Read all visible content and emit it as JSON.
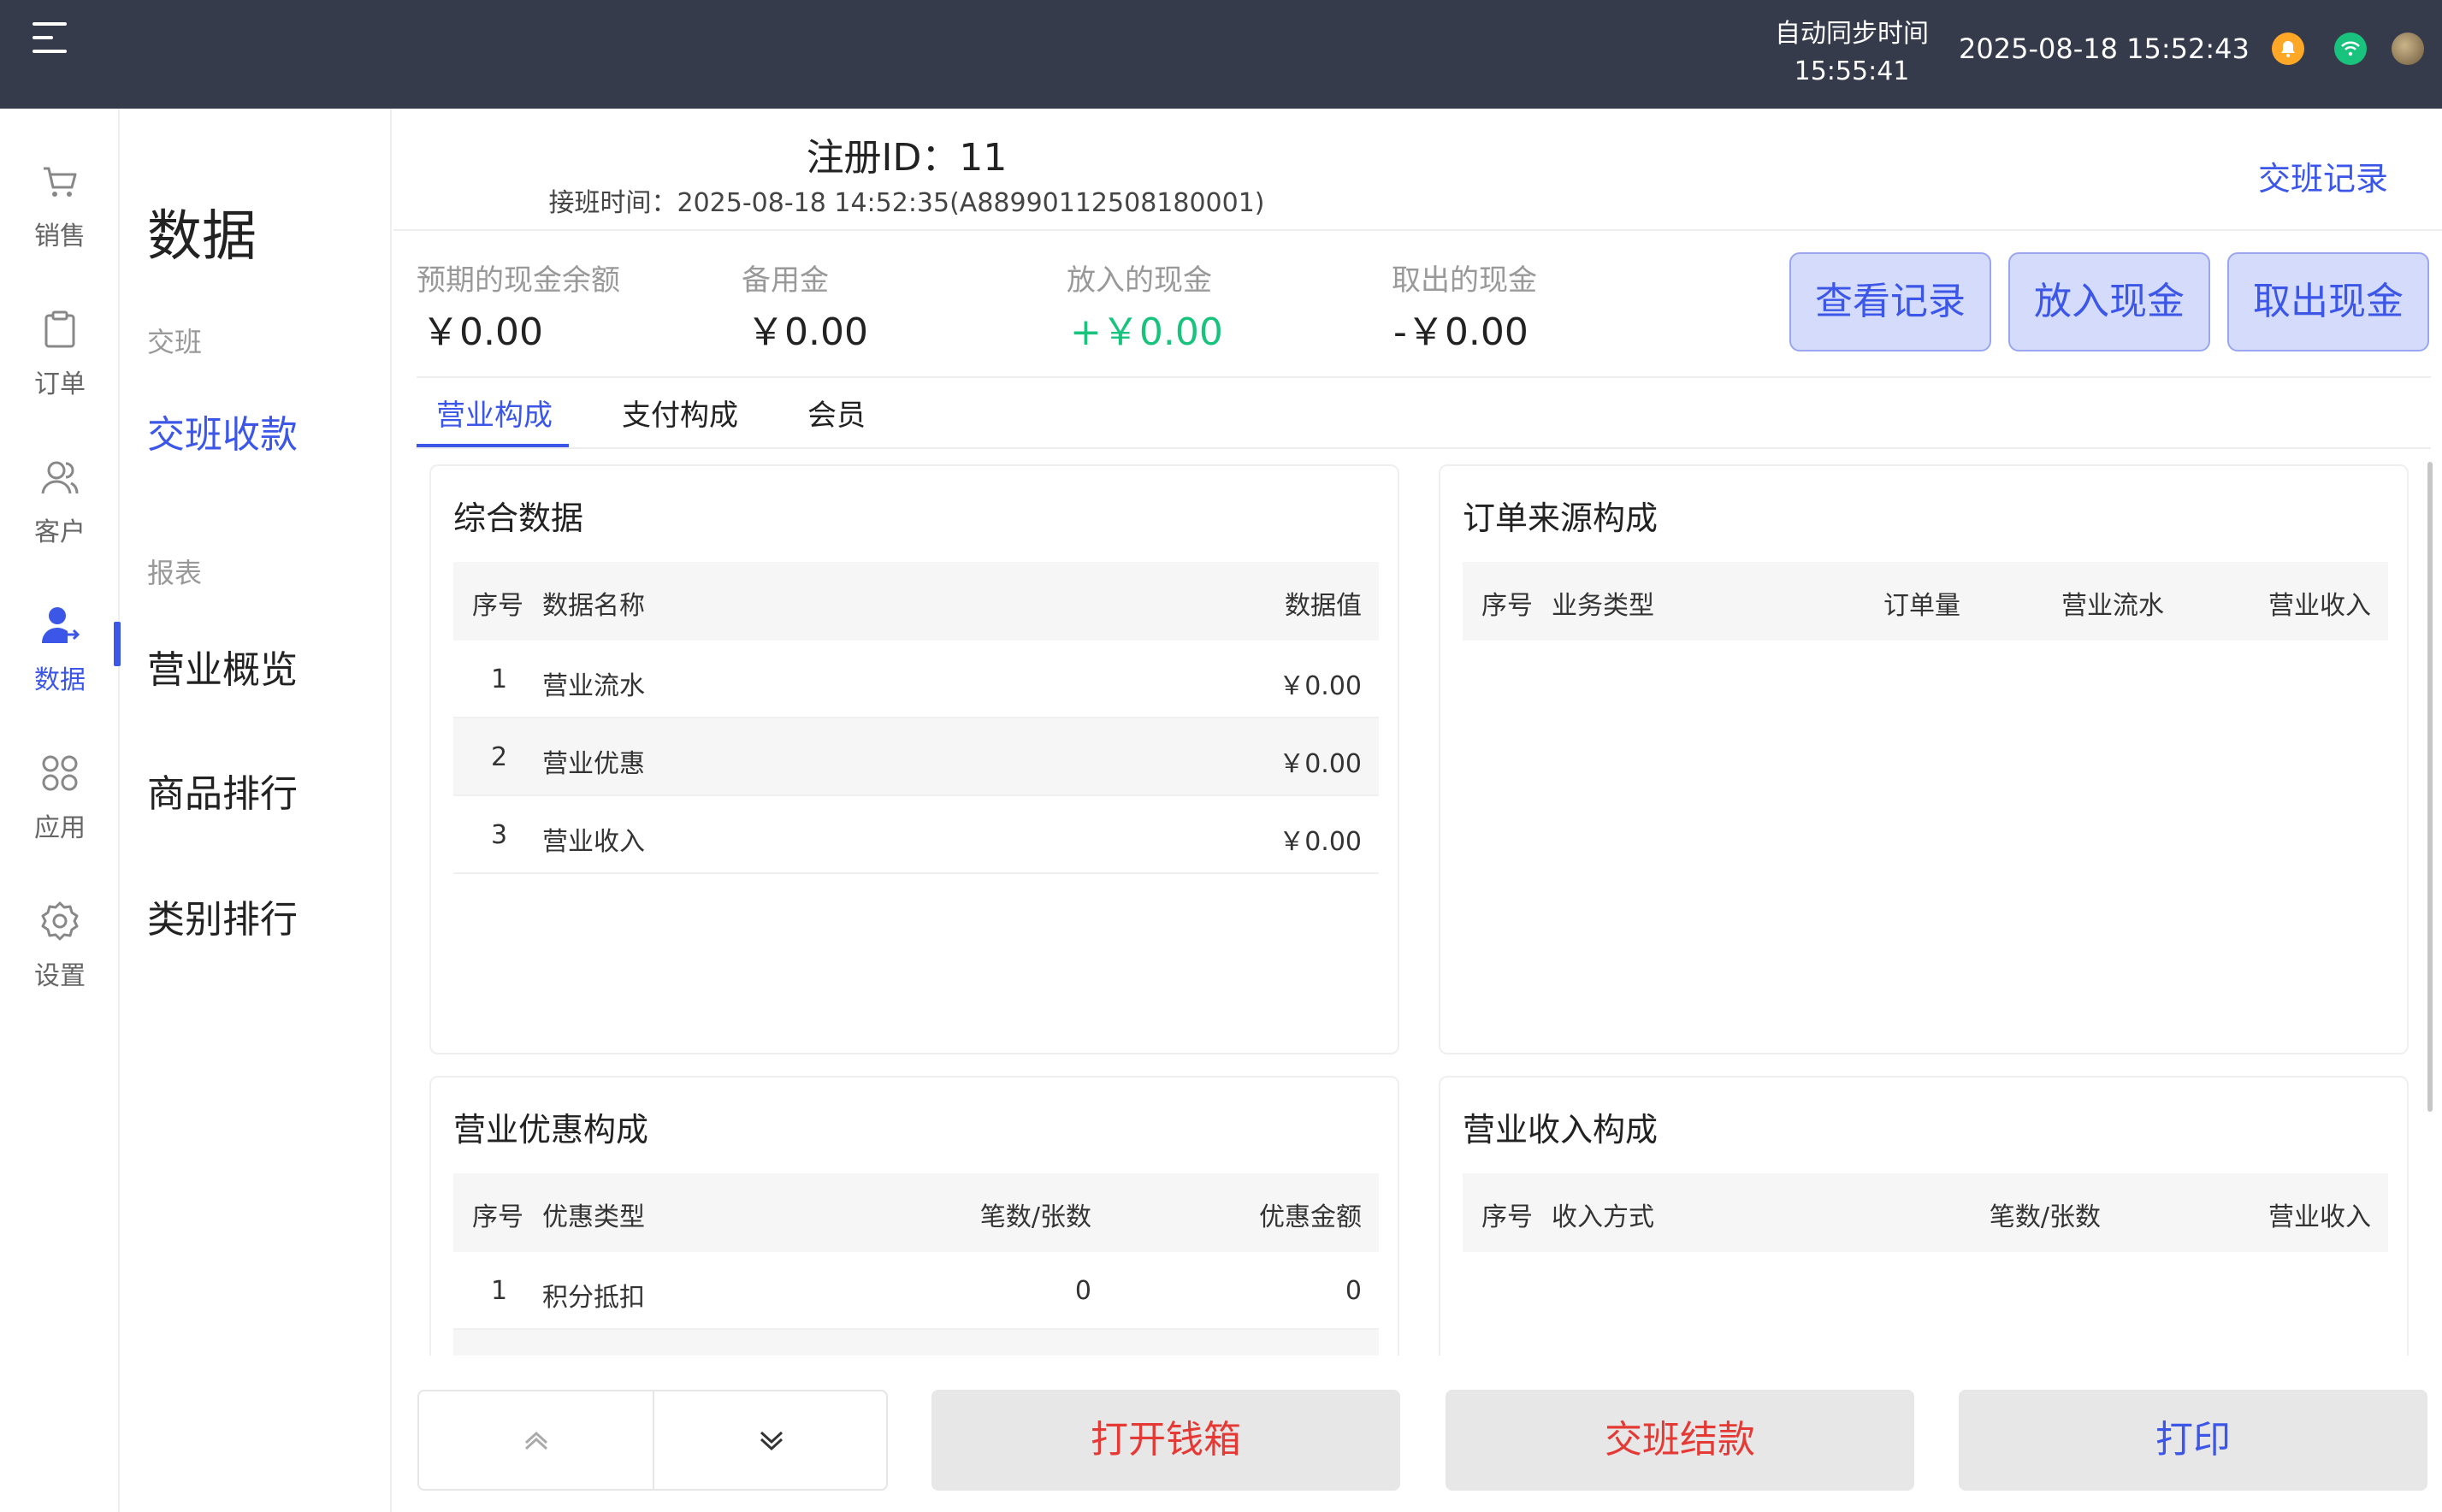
{
  "topbar": {
    "sync_label": "自动同步时间",
    "sync_time": "15:55:41",
    "datetime": "2025-08-18 15:52:43",
    "icons": [
      "menu-icon",
      "bell-icon",
      "wifi-icon",
      "avatar"
    ]
  },
  "leftnav": {
    "items": [
      {
        "label": "销售",
        "icon": "cart-icon"
      },
      {
        "label": "订单",
        "icon": "clipboard-icon"
      },
      {
        "label": "客户",
        "icon": "users-icon"
      },
      {
        "label": "数据",
        "icon": "user-data-icon"
      },
      {
        "label": "应用",
        "icon": "apps-icon"
      },
      {
        "label": "设置",
        "icon": "gear-icon"
      }
    ],
    "active": "数据"
  },
  "subnav": {
    "title": "数据",
    "group1": "交班",
    "item_shift": "交班收款",
    "group2": "报表",
    "item_overview": "营业概览",
    "item_goods": "商品排行",
    "item_category": "类别排行"
  },
  "header": {
    "reg_id": "注册ID：11",
    "shift_time": "接班时间：2025-08-18 14:52:35(A88990112508180001)",
    "shift_record": "交班记录"
  },
  "stats": {
    "expected_label": "预期的现金余额",
    "expected_value": "￥0.00",
    "reserve_label": "备用金",
    "reserve_value": "￥0.00",
    "in_label": "放入的现金",
    "in_value": "+￥0.00",
    "out_label": "取出的现金",
    "out_value": "-￥0.00"
  },
  "buttons": {
    "view_records": "查看记录",
    "put_cash": "放入现金",
    "take_cash": "取出现金"
  },
  "tabs": {
    "business": "营业构成",
    "payment": "支付构成",
    "member": "会员",
    "active": "营业构成"
  },
  "summary": {
    "title": "综合数据",
    "headers": {
      "no": "序号",
      "name": "数据名称",
      "value": "数据值"
    },
    "rows": [
      {
        "no": "1",
        "name": "营业流水",
        "value": "￥0.00"
      },
      {
        "no": "2",
        "name": "营业优惠",
        "value": "￥0.00"
      },
      {
        "no": "3",
        "name": "营业收入",
        "value": "￥0.00"
      }
    ]
  },
  "order_source": {
    "title": "订单来源构成",
    "headers": {
      "no": "序号",
      "type": "业务类型",
      "count": "订单量",
      "flow": "营业流水",
      "income": "营业收入"
    }
  },
  "discount": {
    "title": "营业优惠构成",
    "headers": {
      "no": "序号",
      "type": "优惠类型",
      "count": "笔数/张数",
      "amount": "优惠金额"
    },
    "rows": [
      {
        "no": "1",
        "type": "积分抵扣",
        "count": "0",
        "amount": "0"
      }
    ]
  },
  "income": {
    "title": "营业收入构成",
    "headers": {
      "no": "序号",
      "method": "收入方式",
      "count": "笔数/张数",
      "income": "营业收入"
    }
  },
  "bottom": {
    "open_drawer": "打开钱箱",
    "settle": "交班结款",
    "print": "打印"
  },
  "colors": {
    "topbar": "#363b4b",
    "accent": "#3c57e8",
    "green": "#19c37d",
    "red": "#e53935",
    "bell": "#ffa726"
  }
}
